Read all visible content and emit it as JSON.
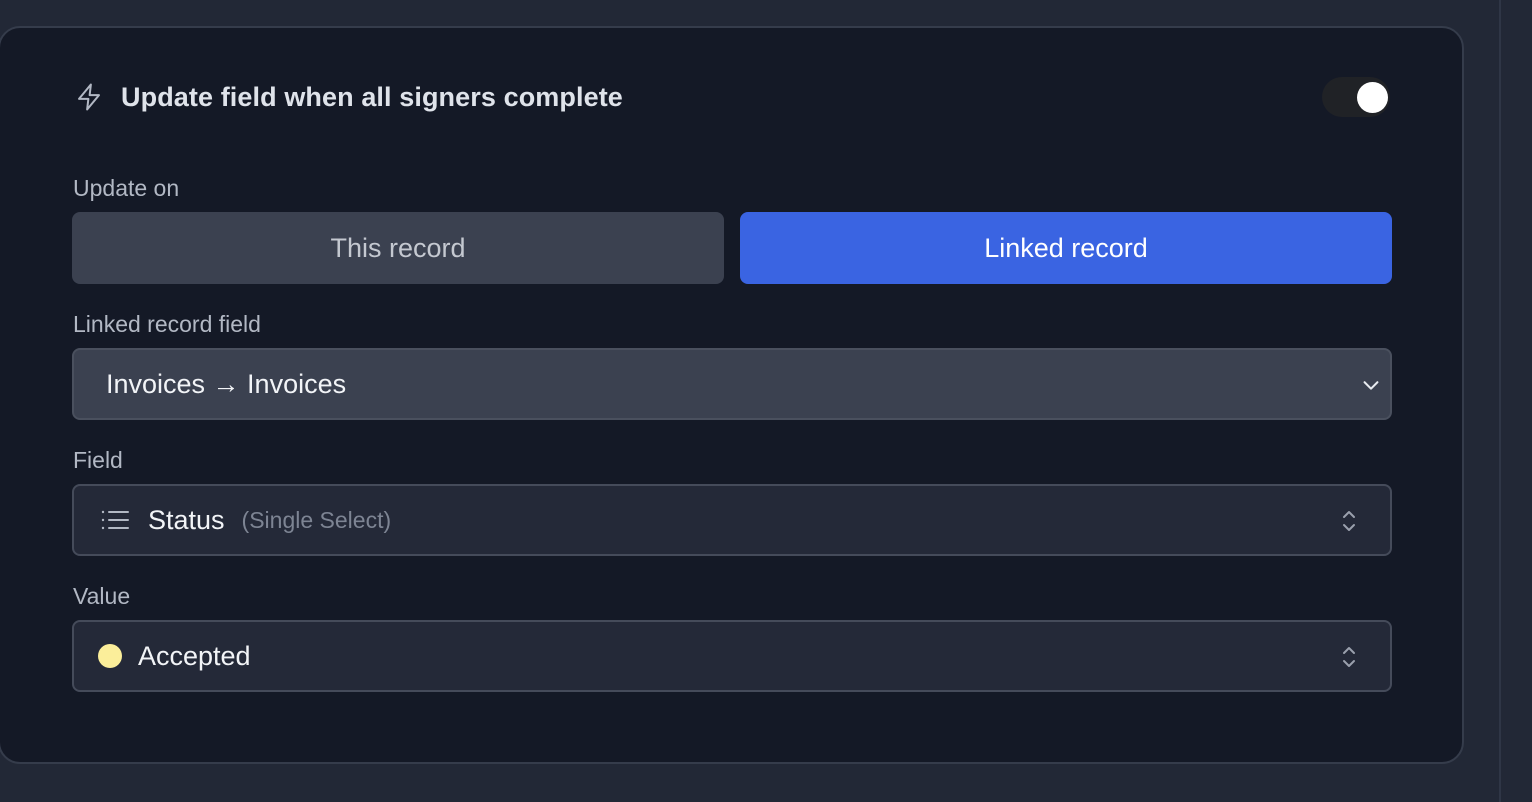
{
  "header": {
    "title": "Update field when all signers complete",
    "icon": "bolt-icon",
    "toggle_on": true
  },
  "update_on": {
    "label": "Update on",
    "options": [
      "This record",
      "Linked record"
    ],
    "selected": "Linked record"
  },
  "linked_record_field": {
    "label": "Linked record field",
    "value": "Invoices → Invoices"
  },
  "field": {
    "label": "Field",
    "icon": "list-icon",
    "value": "Status",
    "type": "(Single Select)"
  },
  "value": {
    "label": "Value",
    "value": "Accepted",
    "dot_color": "#fbee9a"
  },
  "colors": {
    "accent": "#3a64e2",
    "card_bg": "#141926",
    "page_bg": "#222836"
  }
}
